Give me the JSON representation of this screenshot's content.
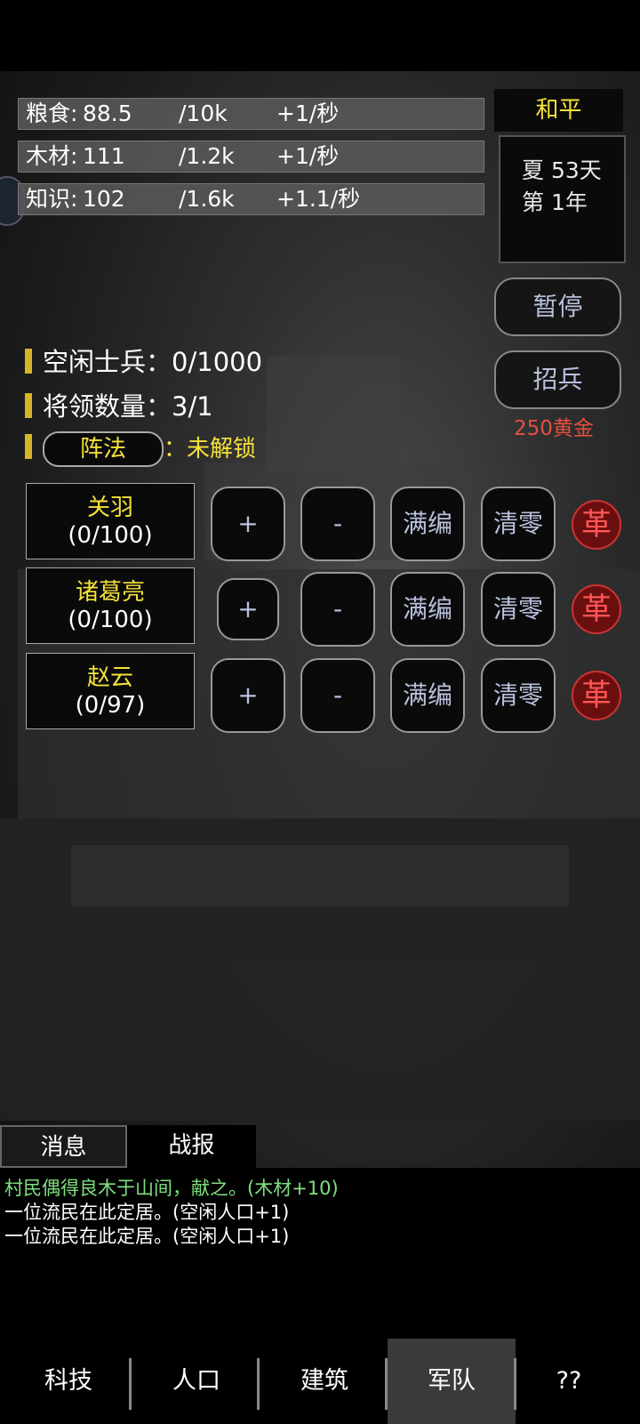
{
  "resources": [
    {
      "name": "粮食",
      "value": "88.5",
      "cap": "/10k",
      "rate": "+1/秒"
    },
    {
      "name": "木材",
      "value": "111",
      "cap": "/1.2k",
      "rate": "+1/秒"
    },
    {
      "name": "知识",
      "value": "102",
      "cap": "/1.6k",
      "rate": "+1.1/秒"
    }
  ],
  "status": {
    "peace": "和平",
    "season_day": "夏 53天",
    "year": "第 1年"
  },
  "actions": {
    "pause": "暂停",
    "recruit": "招兵",
    "recruit_cost": "250黄金"
  },
  "army": {
    "idle_label": "空闲士兵：",
    "idle_value": "0/1000",
    "generals_label": "将领数量：",
    "generals_value": "3/1",
    "formation_button": "阵法",
    "formation_colon": "：",
    "formation_status": "未解锁"
  },
  "generals": [
    {
      "name": "关羽",
      "count": "(0/100)"
    },
    {
      "name": "诸葛亮",
      "count": "(0/100)"
    },
    {
      "name": "赵云",
      "count": "(0/97)"
    }
  ],
  "controls": {
    "plus": "+",
    "minus": "-",
    "fill": "满编",
    "clear": "清零",
    "dismiss": "革"
  },
  "tabs": {
    "messages": "消息",
    "battle": "战报"
  },
  "log": [
    {
      "text": "村民偶得良木于山间，献之。(木材+10)",
      "color": "#7ee07e"
    },
    {
      "text": "一位流民在此定居。(空闲人口+1)",
      "color": "#ffffff"
    },
    {
      "text": "一位流民在此定居。(空闲人口+1)",
      "color": "#ffffff"
    }
  ],
  "nav": [
    {
      "label": "科技"
    },
    {
      "label": "人口"
    },
    {
      "label": "建筑"
    },
    {
      "label": "军队"
    },
    {
      "label": "??"
    }
  ]
}
